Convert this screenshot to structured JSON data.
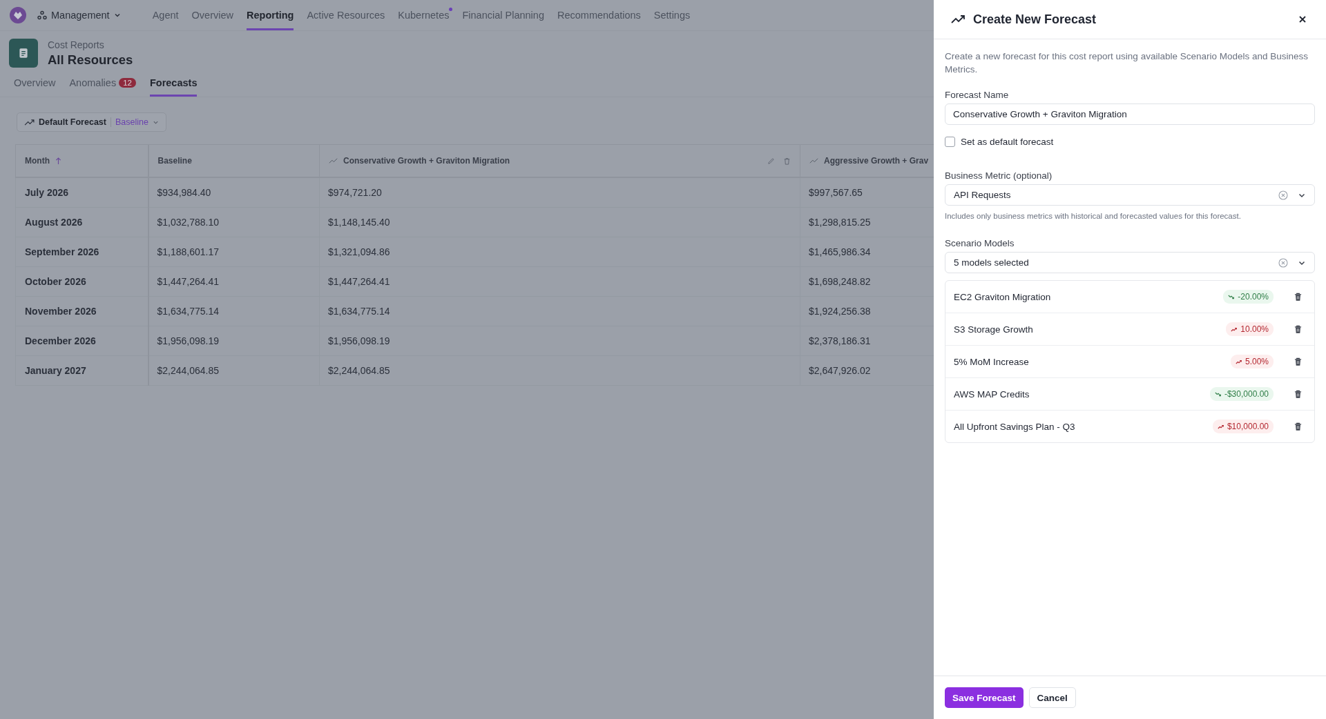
{
  "top_nav": {
    "workspace": "Management",
    "items": [
      {
        "label": "Agent",
        "selected": false,
        "dot": false
      },
      {
        "label": "Overview",
        "selected": false,
        "dot": false
      },
      {
        "label": "Reporting",
        "selected": true,
        "dot": false
      },
      {
        "label": "Active Resources",
        "selected": false,
        "dot": false
      },
      {
        "label": "Kubernetes",
        "selected": false,
        "dot": true
      },
      {
        "label": "Financial Planning",
        "selected": false,
        "dot": false
      },
      {
        "label": "Recommendations",
        "selected": false,
        "dot": false
      },
      {
        "label": "Settings",
        "selected": false,
        "dot": false
      }
    ]
  },
  "page_header": {
    "breadcrumb": "Cost Reports",
    "title": "All Resources"
  },
  "tabs": [
    {
      "label": "Overview",
      "selected": false
    },
    {
      "label": "Anomalies",
      "badge": "12",
      "selected": false
    },
    {
      "label": "Forecasts",
      "selected": true
    }
  ],
  "forecast_picker": {
    "label": "Default Forecast",
    "value": "Baseline"
  },
  "table": {
    "columns": [
      {
        "label": "Month",
        "kind": "plain",
        "sorted": true,
        "editable": false
      },
      {
        "label": "Baseline",
        "kind": "plain",
        "sorted": false,
        "editable": false
      },
      {
        "label": "Conservative Growth + Graviton Migration",
        "kind": "forecast",
        "sorted": false,
        "editable": true
      },
      {
        "label": "Aggressive Growth + Grav",
        "kind": "forecast",
        "sorted": false,
        "editable": false
      }
    ],
    "rows": [
      [
        "July 2026",
        "$934,984.40",
        "$974,721.20",
        "$997,567.65"
      ],
      [
        "August 2026",
        "$1,032,788.10",
        "$1,148,145.40",
        "$1,298,815.25"
      ],
      [
        "September 2026",
        "$1,188,601.17",
        "$1,321,094.86",
        "$1,465,986.34"
      ],
      [
        "October 2026",
        "$1,447,264.41",
        "$1,447,264.41",
        "$1,698,248.82"
      ],
      [
        "November 2026",
        "$1,634,775.14",
        "$1,634,775.14",
        "$1,924,256.38"
      ],
      [
        "December 2026",
        "$1,956,098.19",
        "$1,956,098.19",
        "$2,378,186.31"
      ],
      [
        "January 2027",
        "$2,244,064.85",
        "$2,244,064.85",
        "$2,647,926.02"
      ]
    ]
  },
  "drawer": {
    "title": "Create New Forecast",
    "description": "Create a new forecast for this cost report using available Scenario Models and Business Metrics.",
    "forecast_name": {
      "label": "Forecast Name",
      "value": "Conservative Growth + Graviton Migration"
    },
    "default_checkbox": {
      "label": "Set as default forecast",
      "checked": false
    },
    "business_metric": {
      "label": "Business Metric (optional)",
      "value": "API Requests",
      "helper": "Includes only business metrics with historical and forecasted values for this forecast."
    },
    "scenario_models": {
      "label": "Scenario Models",
      "value": "5 models selected",
      "items": [
        {
          "name": "EC2 Graviton Migration",
          "change": "-20.00%",
          "kind": "decrease"
        },
        {
          "name": "S3 Storage Growth",
          "change": "10.00%",
          "kind": "increase"
        },
        {
          "name": "5% MoM Increase",
          "change": "5.00%",
          "kind": "increase"
        },
        {
          "name": "AWS MAP Credits",
          "change": "-$30,000.00",
          "kind": "decrease"
        },
        {
          "name": "All Upfront Savings Plan - Q3",
          "change": "$10,000.00",
          "kind": "increase"
        }
      ]
    },
    "buttons": [
      {
        "label": "Save Forecast",
        "kind": "primary"
      },
      {
        "label": "Cancel",
        "kind": "secondary"
      }
    ]
  }
}
